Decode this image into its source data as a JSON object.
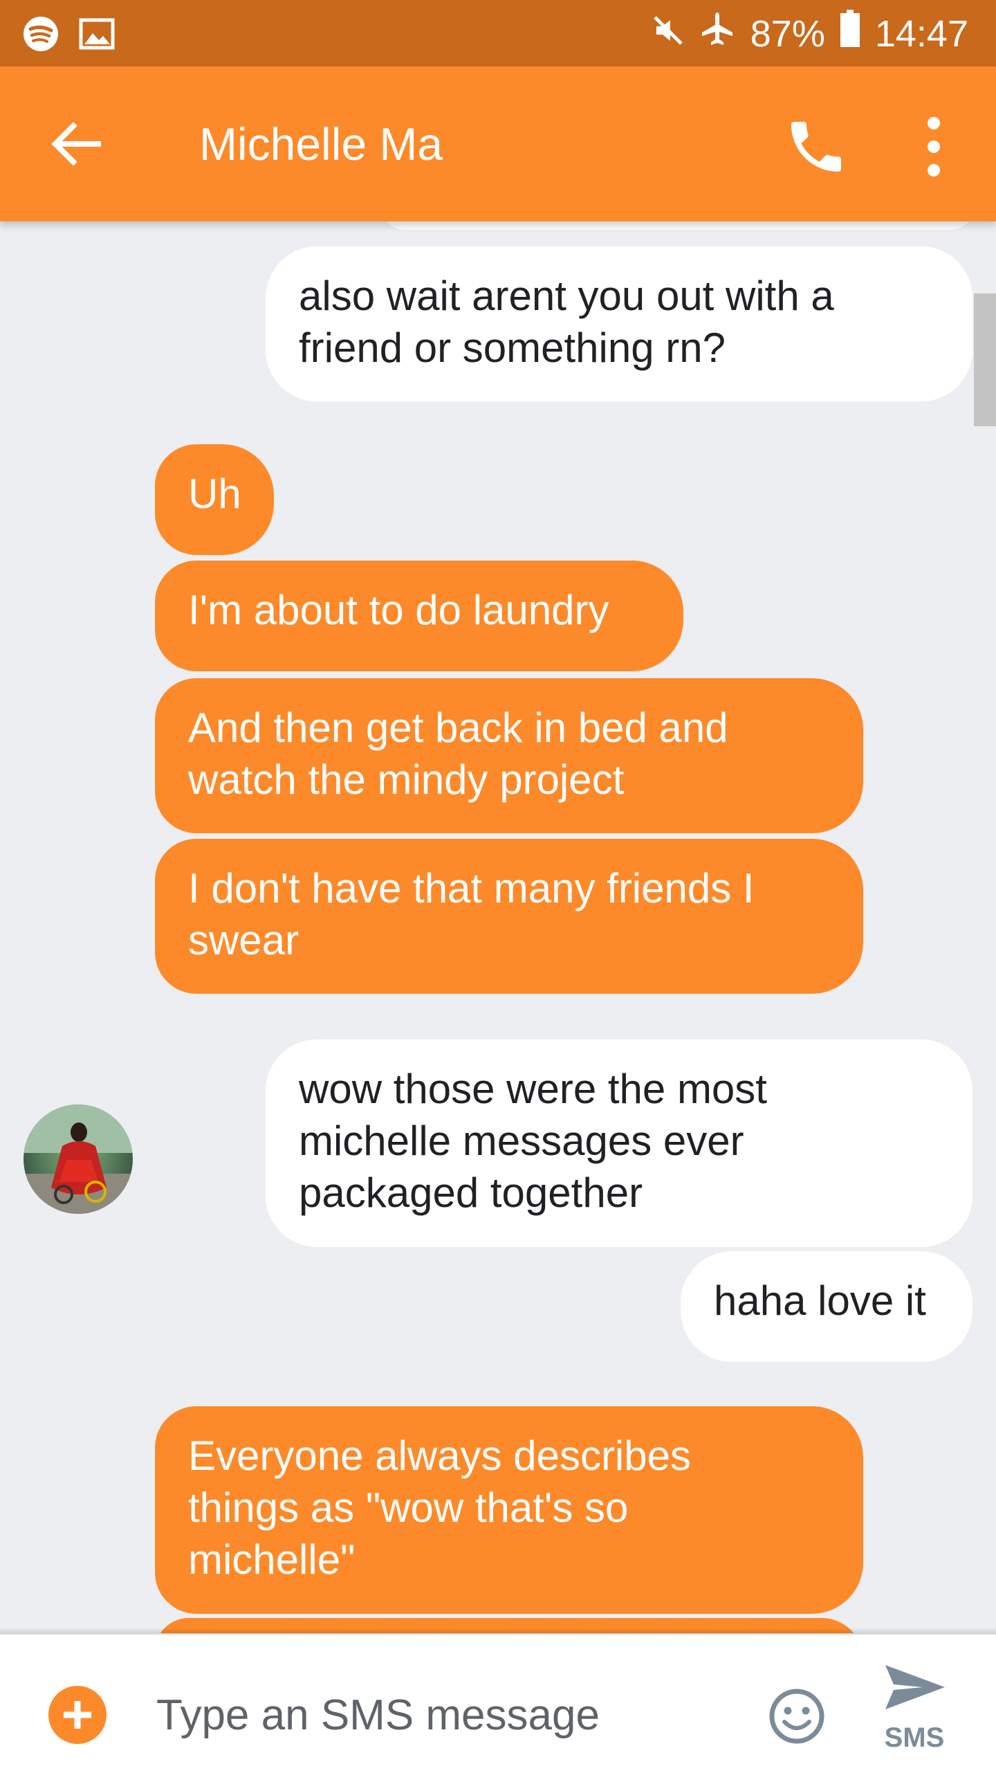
{
  "status_bar": {
    "battery": "87%",
    "time": "14:47",
    "left_icons": [
      "spotify-icon",
      "image-icon"
    ],
    "right_icons": [
      "mute-icon",
      "airplane-icon",
      "battery-icon"
    ]
  },
  "app_bar": {
    "title": "Michelle Ma",
    "icons": [
      "back-arrow-icon",
      "phone-icon",
      "more-vert-icon"
    ]
  },
  "messages": [
    {
      "direction": "outgoing",
      "text": "also wait arent you out with a\nfriend or something rn?"
    },
    {
      "direction": "incoming",
      "text": "Uh"
    },
    {
      "direction": "incoming",
      "text": "I'm about to do laundry"
    },
    {
      "direction": "incoming",
      "text": "And then get back in bed and\nwatch the mindy project"
    },
    {
      "direction": "incoming",
      "text": "I don't have that many friends I\nswear"
    },
    {
      "direction": "outgoing",
      "text": "wow those were the most\nmichelle messages ever\npackaged together"
    },
    {
      "direction": "outgoing",
      "text": "haha love it"
    },
    {
      "direction": "incoming",
      "text": "Everyone always describes\nthings as \"wow that's so\nmichelle\""
    }
  ],
  "compose": {
    "placeholder": "Type an SMS message",
    "send_label": "SMS",
    "icons": [
      "add-icon",
      "emoji-icon",
      "send-icon"
    ]
  },
  "colors": {
    "status_bar": "#c9691c",
    "app_bar": "#fd8a2a",
    "incoming_bubble": "#fd8a2a",
    "outgoing_bubble": "#ffffff",
    "background": "#eceef1"
  }
}
